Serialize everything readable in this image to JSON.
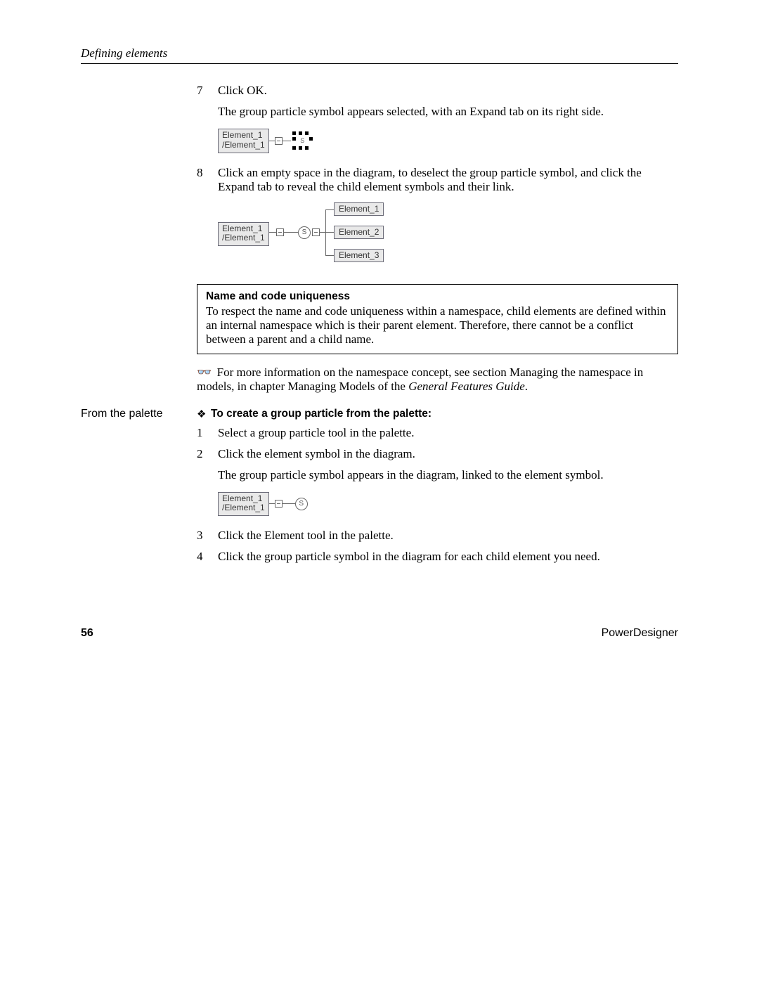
{
  "header": {
    "section_title": "Defining elements"
  },
  "steps_a": {
    "s7": {
      "num": "7",
      "line1": "Click OK.",
      "line2": "The group particle symbol appears selected, with an Expand tab on its right side."
    },
    "s8": {
      "num": "8",
      "line1": "Click an empty space in the diagram, to deselect the group particle symbol, and click the Expand tab to reveal the child element symbols and their link."
    }
  },
  "diagram1": {
    "element_top": "Element_1",
    "element_bottom": "/Element_1",
    "s_label": "S"
  },
  "diagram2": {
    "root_top": "Element_1",
    "root_bottom": "/Element_1",
    "s_label": "S",
    "child1": "Element_1",
    "child2": "Element_2",
    "child3": "Element_3"
  },
  "infobox": {
    "title": "Name and code uniqueness",
    "body": "To respect the name and code uniqueness within a namespace, child elements are defined within an internal namespace which is their parent element. Therefore, there cannot be a conflict between a parent and a child name."
  },
  "reference": {
    "glasses": "👓",
    "text_before": "For more information on the namespace concept, see section Managing the namespace in models, in chapter Managing Models of the ",
    "italic": "General Features Guide",
    "after": "."
  },
  "side_label": "From the palette",
  "section2": {
    "bullet": "❖",
    "heading": "To create a group particle from the palette:",
    "s1": {
      "num": "1",
      "text": "Select a group particle tool in the palette."
    },
    "s2": {
      "num": "2",
      "text": "Click the element symbol in the diagram."
    },
    "s2b": "The group particle symbol appears in the diagram, linked to the element symbol.",
    "s3": {
      "num": "3",
      "text": "Click the Element tool in the palette."
    },
    "s4": {
      "num": "4",
      "text": "Click the group particle symbol in the diagram for each child element you need."
    }
  },
  "diagram3": {
    "element_top": "Element_1",
    "element_bottom": "/Element_1",
    "s_label": "S"
  },
  "footer": {
    "page_number": "56",
    "product": "PowerDesigner"
  }
}
